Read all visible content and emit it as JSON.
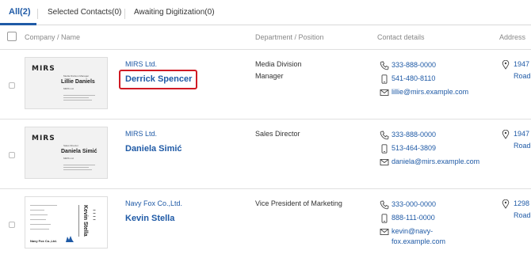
{
  "tabs": [
    {
      "label": "All(2)",
      "active": true
    },
    {
      "label": "Selected Contacts(0)",
      "active": false
    },
    {
      "label": "Awaiting Digitization(0)",
      "active": false
    }
  ],
  "columns": {
    "company_name": "Company / Name",
    "department": "Department / Position",
    "contact": "Contact details",
    "address": "Address"
  },
  "contacts": [
    {
      "company": "MIRS Ltd.",
      "name": "Derrick Spencer",
      "department": "Media Division",
      "position": "Manager",
      "phone": "333-888-0000",
      "mobile": "541-480-8110",
      "email": "lillie@mirs.example.com",
      "address_line1": "1947",
      "address_line2": "Road",
      "card": {
        "logo": "MIRS",
        "title": "Media Division Manager",
        "name": "Lillie Daniels",
        "company": "MIRS Ltd."
      }
    },
    {
      "company": "MIRS Ltd.",
      "name": "Daniela Simić",
      "department": "Sales Director",
      "position": "",
      "phone": "333-888-0000",
      "mobile": "513-464-3809",
      "email": "daniela@mirs.example.com",
      "address_line1": "1947",
      "address_line2": "Road",
      "card": {
        "logo": "MIRS",
        "title": "Sales Director",
        "name": "Daniela Simić",
        "company": "MIRS Ltd."
      }
    },
    {
      "company": "Navy Fox Co.,Ltd.",
      "name": "Kevin Stella",
      "department": "Vice President of Marketing",
      "position": "",
      "phone": "333-000-0000",
      "mobile": "888-111-0000",
      "email_line1": "kevin@navy-",
      "email_line2": "fox.example.com",
      "address_line1": "1298",
      "address_line2": "Road",
      "card": {
        "logo": "Navy Fox Co.,Ltd.",
        "name": "Kevin Stella"
      }
    }
  ],
  "colors": {
    "accent": "#1f5aa6",
    "highlight": "#d01a24"
  },
  "icons": [
    "phone-icon",
    "mobile-icon",
    "mail-icon",
    "location-pin-icon"
  ]
}
